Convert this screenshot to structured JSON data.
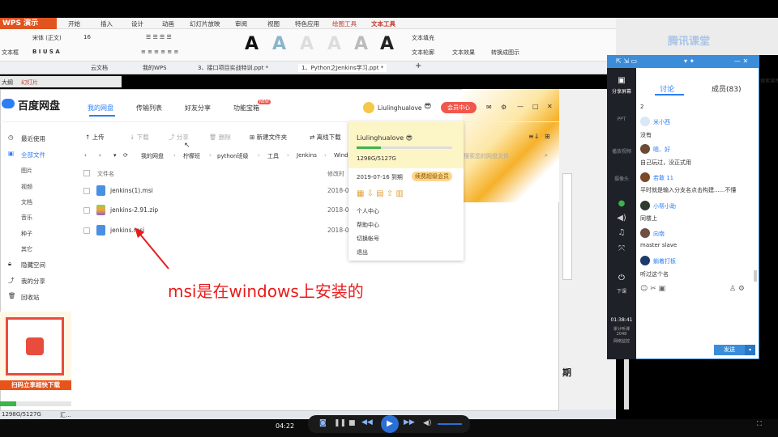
{
  "wps": {
    "app_name": "WPS 演示",
    "menu": [
      "开始",
      "插入",
      "设计",
      "动画",
      "幻灯片放映",
      "审阅",
      "视图",
      "特色应用",
      "绘图工具",
      "文本工具"
    ],
    "active_menu": "文本工具",
    "font_name": "宋体 (正文)",
    "font_size": "16",
    "ribbon": {
      "text_box": "文本框",
      "text_fill": "文本填充",
      "text_outline": "文本轮廓",
      "text_effect": "文本效果",
      "convert": "转换成图示"
    },
    "tabs": [
      "云文档",
      "我的WPS",
      "3、接口项目实战特训.ppt *",
      "1、Python之Jenkins学习.ppt *"
    ],
    "outline_tabs": [
      "大纲",
      "幻灯片"
    ],
    "status": "1298G/5127G",
    "status_right": "汇..."
  },
  "baidu": {
    "logo": "百度网盘",
    "nav": [
      "我的网盘",
      "传输列表",
      "好友分享",
      "功能宝箱"
    ],
    "new_badge": "NEW",
    "username": "Liulinghualove",
    "vip_button": "会员中心",
    "sidebar": [
      "最近使用",
      "全部文件",
      "图片",
      "视频",
      "文档",
      "音乐",
      "种子",
      "其它",
      "隐藏空间",
      "我的分享",
      "回收站"
    ],
    "toolbar": [
      "上传",
      "下载",
      "分享",
      "删除",
      "新建文件夹",
      "离线下载"
    ],
    "breadcrumb": [
      "我的网盘",
      "柠檬班",
      "python班级",
      "工具",
      "Jenkins",
      "Wind"
    ],
    "search_placeholder": "搜索您的网盘文件",
    "columns": {
      "name": "文件名",
      "date": "修改时"
    },
    "files": [
      {
        "name": "jenkins(1).msi",
        "date": "2018-0"
      },
      {
        "name": "jenkins-2.91.zip",
        "date": "2018-0"
      },
      {
        "name": "jenkins.msi",
        "date": "2018-0"
      }
    ],
    "promo": "扫码立享超快下载",
    "storage": "1298G/5127G"
  },
  "popup": {
    "username": "Liulinghualove",
    "storage": "1298G/5127G",
    "expiry": "2019-07-16 到期",
    "renew": "续费超级会员",
    "menu": [
      "个人中心",
      "帮助中心",
      "切换帐号",
      "退出"
    ]
  },
  "annotation": "msi是在windows上安装的",
  "chat": {
    "tabs": [
      "讨论",
      "成员(83)"
    ],
    "left": [
      "分享屏幕",
      "PPT",
      "播放视频",
      "摄像头",
      "下课"
    ],
    "timer": "01:38:41",
    "stats": "累计听课 2048",
    "net": "网络监控",
    "messages": [
      {
        "who": "",
        "text": "2"
      },
      {
        "who": "米小西",
        "text": "没有"
      },
      {
        "who": "嗯、好",
        "text": "自己玩过，没正式用"
      },
      {
        "who": "若敢 11",
        "text": "平时就是输入分支名点击构建......不懂"
      },
      {
        "who": "小帮小助",
        "text": "同楼上"
      },
      {
        "who": "向南",
        "text": "master slave"
      },
      {
        "who": "躺着打板",
        "text": "听过这个名"
      }
    ],
    "send": "发送",
    "right_edge": "搜索课件"
  },
  "player": {
    "time": "04:22"
  },
  "brand": "腾讯课堂",
  "slide_char": "期"
}
